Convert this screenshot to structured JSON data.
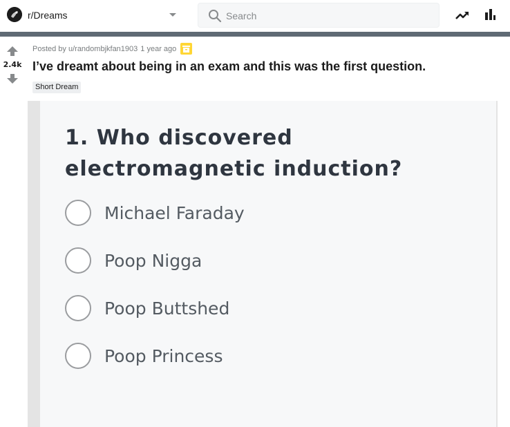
{
  "header": {
    "subreddit": "r/Dreams",
    "search_placeholder": "Search",
    "icons": [
      "subreddit-avatar-icon",
      "chevron-down-icon",
      "search-icon",
      "trending-icon",
      "stats-icon"
    ]
  },
  "post": {
    "votes": "2.4k",
    "posted_by": "Posted by u/randombjkfan1903",
    "time": "1 year ago",
    "title": "I’ve dreamt about being in an exam and this was the first question.",
    "flair": "Short Dream"
  },
  "quiz": {
    "question": "1. Who discovered electromagnetic induction?",
    "options": [
      {
        "label": "Michael Faraday"
      },
      {
        "label": "Poop Nigga"
      },
      {
        "label": "Poop Buttshed"
      },
      {
        "label": "Poop Princess"
      }
    ]
  },
  "colors": {
    "banner": "#5f6a74",
    "archive": "#ffd635",
    "question_text": "#2f3640",
    "option_text": "#545b62"
  }
}
